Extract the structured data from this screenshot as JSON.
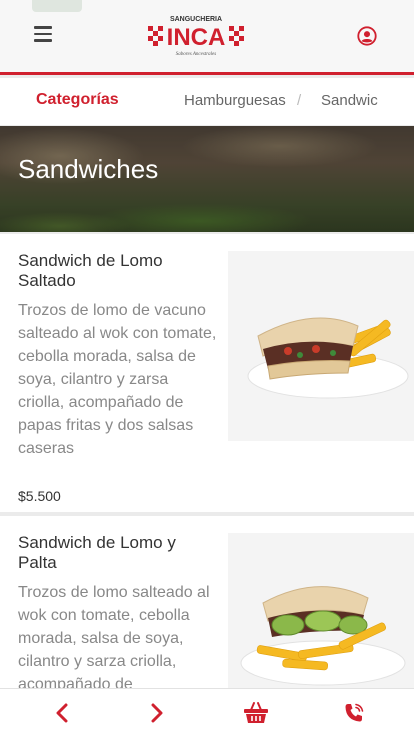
{
  "header": {
    "logo_top": "SANGUCHERIA",
    "logo_main": "INCA",
    "logo_sub": "Sabores Ancestrales",
    "brand_color": "#d0202e"
  },
  "categories": {
    "title": "Categorías",
    "items": [
      "Hamburguesas",
      "Sandwic"
    ],
    "separator": "/"
  },
  "banner": {
    "title": "Sandwiches"
  },
  "products": [
    {
      "name": "Sandwich de Lomo Saltado",
      "description": "Trozos de lomo de vacuno salteado al wok con tomate, cebolla morada, salsa de soya, cilantro y zarsa criolla, acompañado de papas fritas y dos salsas caseras",
      "price": "$5.500"
    },
    {
      "name": "Sandwich de Lomo y Palta",
      "description": "Trozos de lomo salteado al wok con tomate, cebolla morada, salsa de soya, cilantro y sarza criolla, acompañado de"
    }
  ],
  "bottom_nav": {
    "icons": [
      "chevron-left-icon",
      "chevron-right-icon",
      "basket-icon",
      "phone-icon"
    ]
  }
}
